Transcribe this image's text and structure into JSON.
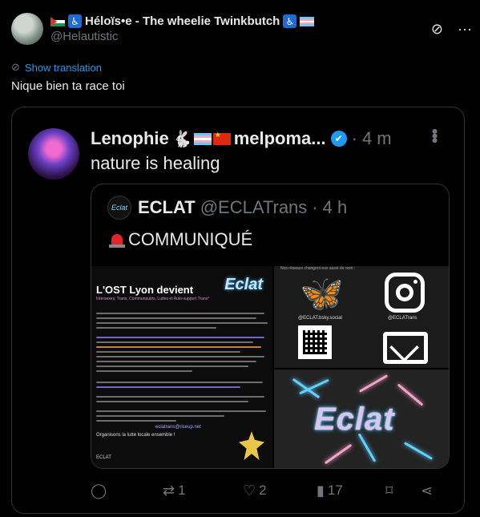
{
  "post": {
    "display_name": "Héloïs•e - The wheelie Twinkbutch",
    "handle": "@Helautistic",
    "show_translation": "Show translation",
    "text": "Nique bien ta race toi",
    "icons": [
      "palestine-flag",
      "wheelchair-icon",
      "trans-flag",
      "grok-icon",
      "more-icon"
    ]
  },
  "quote": {
    "display_name": "Lenophie",
    "display_name_2": "melpoma...",
    "time_sep": "·",
    "time": "4 m",
    "text": "nature is healing",
    "verified": true
  },
  "inner": {
    "avatar_text": "Eclat",
    "display_name": "ECLAT",
    "handle": "@ECLATrans",
    "time_sep": "·",
    "time": "4 h",
    "text": "COMMUNIQUÉ",
    "media": {
      "doc_title": "L'OST Lyon devient",
      "doc_sub": "Intersexes, Trans, Communautés, Luttes et Auto-support Trans*",
      "doc_logo": "Eclat",
      "doc_footer": "ECLAT",
      "doc_email": "eclatrans@riseup.net",
      "doc_closing": "Organisons la lutte locale ensemble !",
      "social_header": "Nos réseaux changent eux aussi de nom :",
      "bsky": "@ECLAT.bsky.social",
      "insta": "@ECLATrans",
      "big_logo": "Eclat"
    }
  },
  "actions": {
    "retweets": "1",
    "likes": "2",
    "views": "17"
  },
  "colors": {
    "background": "#000000",
    "text": "#e7e9ea",
    "muted": "#71767b",
    "link": "#1d9bf0",
    "border": "#2f3336"
  }
}
